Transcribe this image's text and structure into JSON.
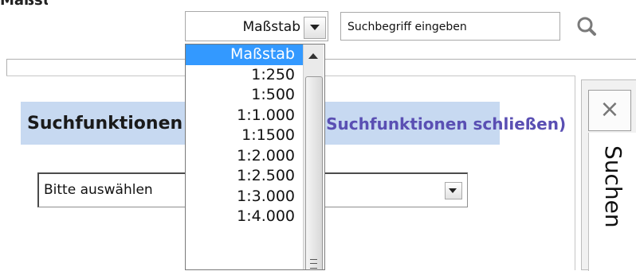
{
  "header": {
    "title_fragment": "Maßstab"
  },
  "toolbar": {
    "scale_select": {
      "value": "Maßstab"
    },
    "search": {
      "placeholder": "Suchbegriff eingeben"
    }
  },
  "main": {
    "heading": "Suchfunktionen",
    "heading_close": "(Suchfunktionen schließen)",
    "function_select": {
      "value": "Bitte auswählen"
    }
  },
  "side_tab": {
    "close_symbol": "×",
    "label": "Suchen"
  },
  "dropdown": {
    "options": [
      "Maßstab",
      "1:250",
      "1:500",
      "1:1.000",
      "1:1500",
      "1:2.000",
      "1:2.500",
      "1:3.000",
      "1:4.000"
    ],
    "selected_index": 0
  },
  "colors": {
    "heading_bg": "#c7d9f1",
    "selection": "#3399ff",
    "link": "#5a4fb3"
  }
}
